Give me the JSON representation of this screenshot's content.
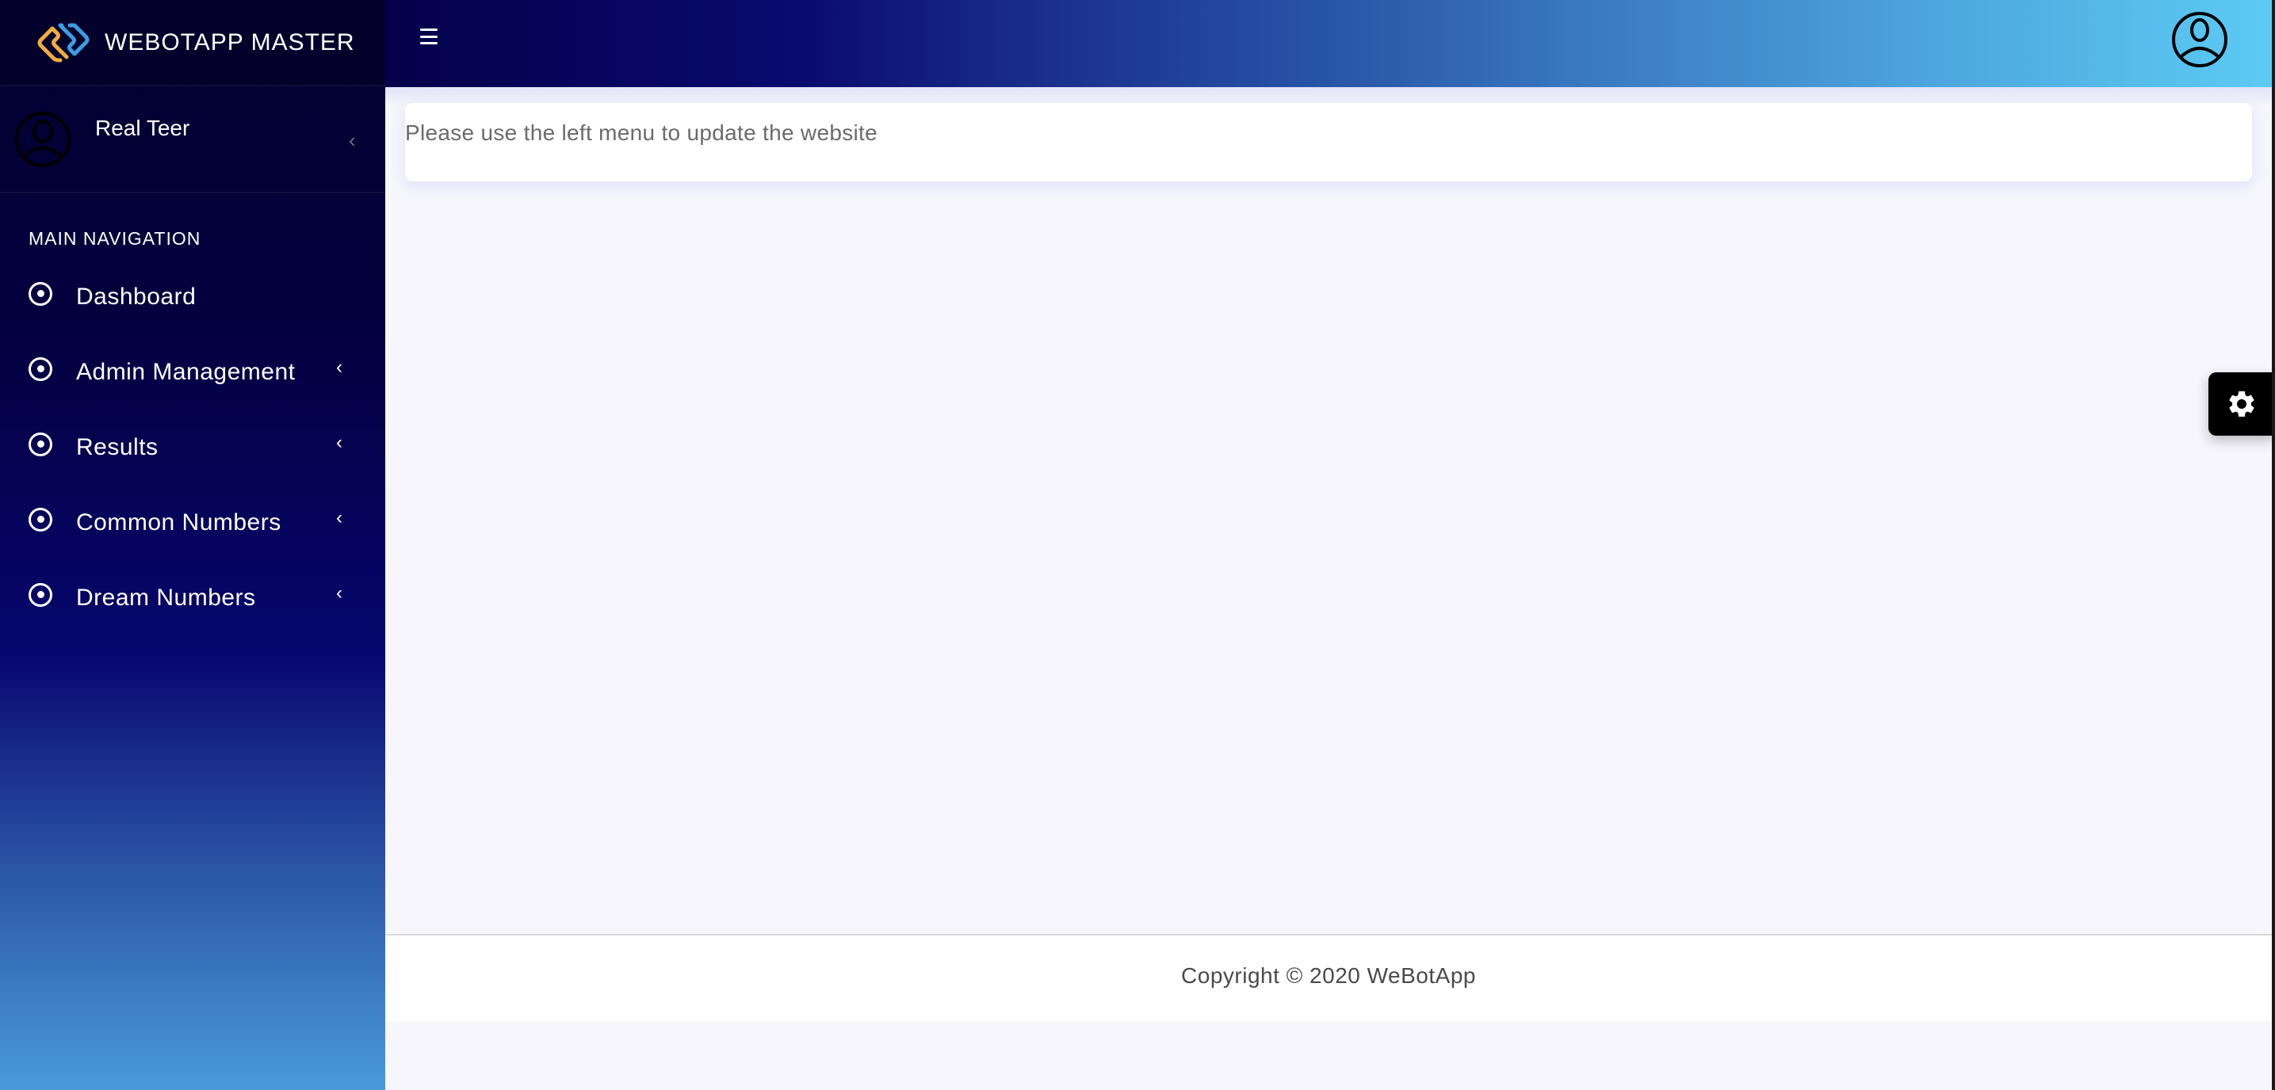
{
  "brand": {
    "title": "WEBOTAPP MASTER",
    "logo_icon": "interlocked-diamonds-logo",
    "colors": {
      "logo_orange": "#F0AD3E",
      "logo_blue": "#3B9DE0"
    }
  },
  "user": {
    "name": "Real Teer",
    "avatar_icon": "user-circle-icon",
    "toggle_icon": "chevron-left-icon"
  },
  "sidebar": {
    "section_header": "MAIN NAVIGATION",
    "items": [
      {
        "label": "Dashboard",
        "icon": "dot-circle-icon",
        "has_submenu": false
      },
      {
        "label": "Admin Management",
        "icon": "dot-circle-icon",
        "has_submenu": true,
        "chevron": "‹"
      },
      {
        "label": "Results",
        "icon": "dot-circle-icon",
        "has_submenu": true,
        "chevron": "‹"
      },
      {
        "label": "Common Numbers",
        "icon": "dot-circle-icon",
        "has_submenu": true,
        "chevron": "‹"
      },
      {
        "label": "Dream Numbers",
        "icon": "dot-circle-icon",
        "has_submenu": true,
        "chevron": "‹"
      }
    ],
    "colors": {
      "gradient_top": "#02002F",
      "gradient_bottom": "#4A9AD8"
    }
  },
  "topbar": {
    "menu_icon": "hamburger-icon",
    "profile_icon": "user-circle-icon",
    "colors": {
      "gradient_start": "#04004A",
      "gradient_end": "#5CCBF5"
    }
  },
  "main": {
    "message": "Please use the left menu to update the website"
  },
  "footer": {
    "copyright": "Copyright © 2020 WeBotApp"
  },
  "settings": {
    "icon": "gear-icon"
  },
  "user_chevron": "‹"
}
